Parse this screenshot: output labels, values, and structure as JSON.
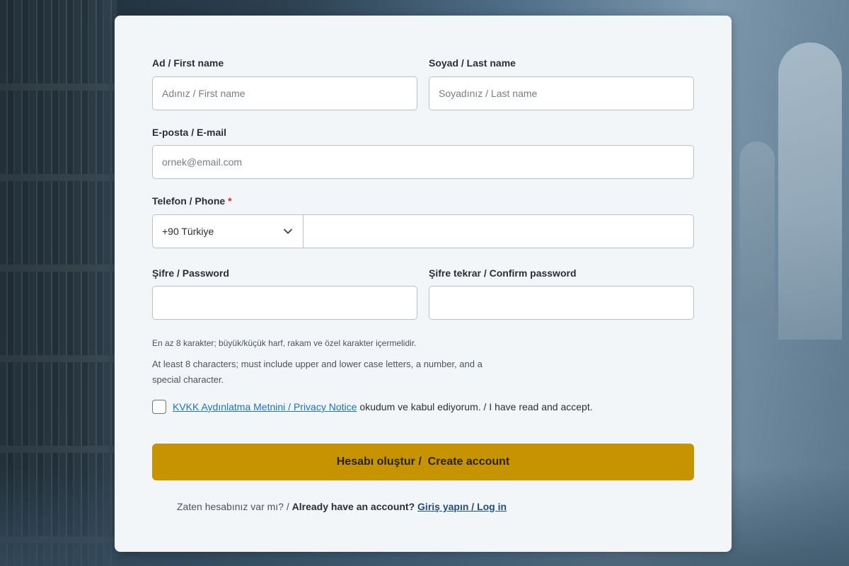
{
  "form": {
    "first_name": {
      "label": "Ad / First name",
      "placeholder": "Adınız / First name"
    },
    "last_name": {
      "label": "Soyad / Last name",
      "placeholder": "Soyadınız / Last name"
    },
    "email": {
      "label": "E-posta / E-mail",
      "placeholder": "ornek@email.com"
    },
    "phone": {
      "label": "Telefon / Phone",
      "required_mark": "*",
      "country_selected": "+90 Türkiye",
      "value": ""
    },
    "password": {
      "label": "Şifre / Password"
    },
    "confirm_password": {
      "label": "Şifre tekrar / Confirm password"
    },
    "password_hint_tr": "En az 8 karakter; büyük/küçük harf, rakam ve özel karakter içermelidir.",
    "password_hint_en": "At least 8 characters; must include upper and lower case letters, a number, and a special character.",
    "consent": {
      "link_text": "KVKK Aydınlatma Metnini / Privacy Notice",
      "text": "okudum ve kabul ediyorum. / I have read and accept.",
      "checked": false
    },
    "submit_label": "Hesabı oluştur /  Create account",
    "login_prompt": "Zaten hesabınız var mı? /",
    "login_prompt_en": "Already have an account?",
    "login_link": "Giriş yapın / Log in"
  },
  "colors": {
    "card_bg": "#f3f6f9",
    "accent_button": "#c59400",
    "link": "#1a73c9",
    "required": "#d02a2a"
  },
  "icons": {
    "country_dropdown": "chevron-down-icon"
  }
}
